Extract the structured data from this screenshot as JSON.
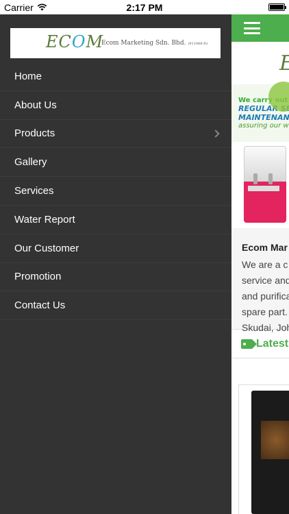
{
  "status_bar": {
    "carrier": "Carrier",
    "time": "2:17 PM",
    "wifi_icon": "wifi-icon",
    "battery_level": 1.0
  },
  "drawer": {
    "logo": {
      "mark": "EC",
      "mark_o": "O",
      "mark_end": "M",
      "company": "Ecom Marketing Sdn. Bhd.",
      "reg": "(911088-D)"
    },
    "items": [
      {
        "label": "Home",
        "has_submenu": false
      },
      {
        "label": "About Us",
        "has_submenu": false
      },
      {
        "label": "Products",
        "has_submenu": true
      },
      {
        "label": "Gallery",
        "has_submenu": false
      },
      {
        "label": "Services",
        "has_submenu": false
      },
      {
        "label": "Water Report",
        "has_submenu": false
      },
      {
        "label": "Our Customer",
        "has_submenu": false
      },
      {
        "label": "Promotion",
        "has_submenu": false
      },
      {
        "label": "Contact Us",
        "has_submenu": false
      }
    ]
  },
  "main": {
    "menu_icon": "hamburger-icon",
    "logo_letter": "E",
    "banner": {
      "line1": "We carry out",
      "line2": "REGULAR SE",
      "line3": "MAINTENANC",
      "line4": "assuring our w"
    },
    "about": {
      "title": "Ecom Mar",
      "lines": [
        "We are a c",
        "service and",
        "and purifica",
        "spare part.",
        "Skudai, Joh"
      ]
    },
    "latest_label": "Latest"
  },
  "colors": {
    "drawer_bg": "#333333",
    "accent_green": "#4cae4c",
    "menu_text": "#ffffff"
  }
}
